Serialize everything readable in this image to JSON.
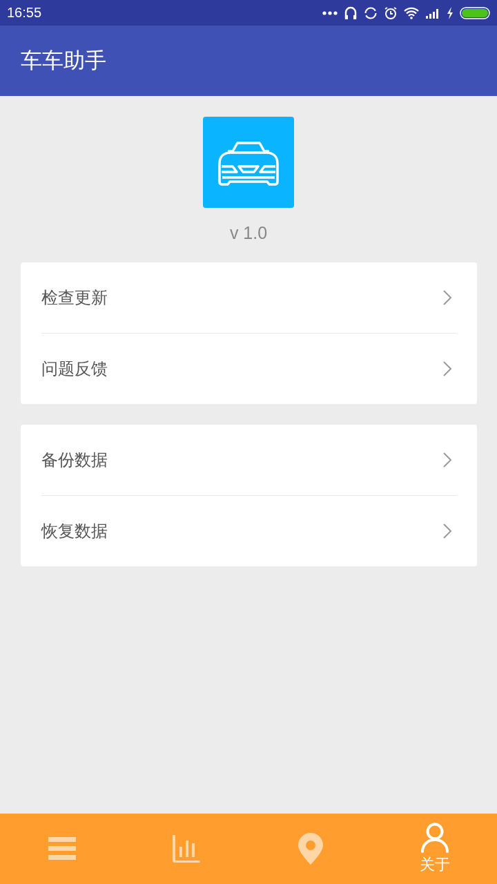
{
  "status_bar": {
    "time": "16:55"
  },
  "app_bar": {
    "title": "车车助手"
  },
  "about": {
    "version": "v 1.0"
  },
  "groups": [
    {
      "items": [
        {
          "label": "检查更新"
        },
        {
          "label": "问题反馈"
        }
      ]
    },
    {
      "items": [
        {
          "label": "备份数据"
        },
        {
          "label": "恢复数据"
        }
      ]
    }
  ],
  "bottom_nav": [
    {
      "kind": "list",
      "selected": false
    },
    {
      "kind": "chart",
      "selected": false
    },
    {
      "kind": "pin",
      "selected": false
    },
    {
      "kind": "person",
      "selected": true,
      "label": "关于"
    }
  ]
}
